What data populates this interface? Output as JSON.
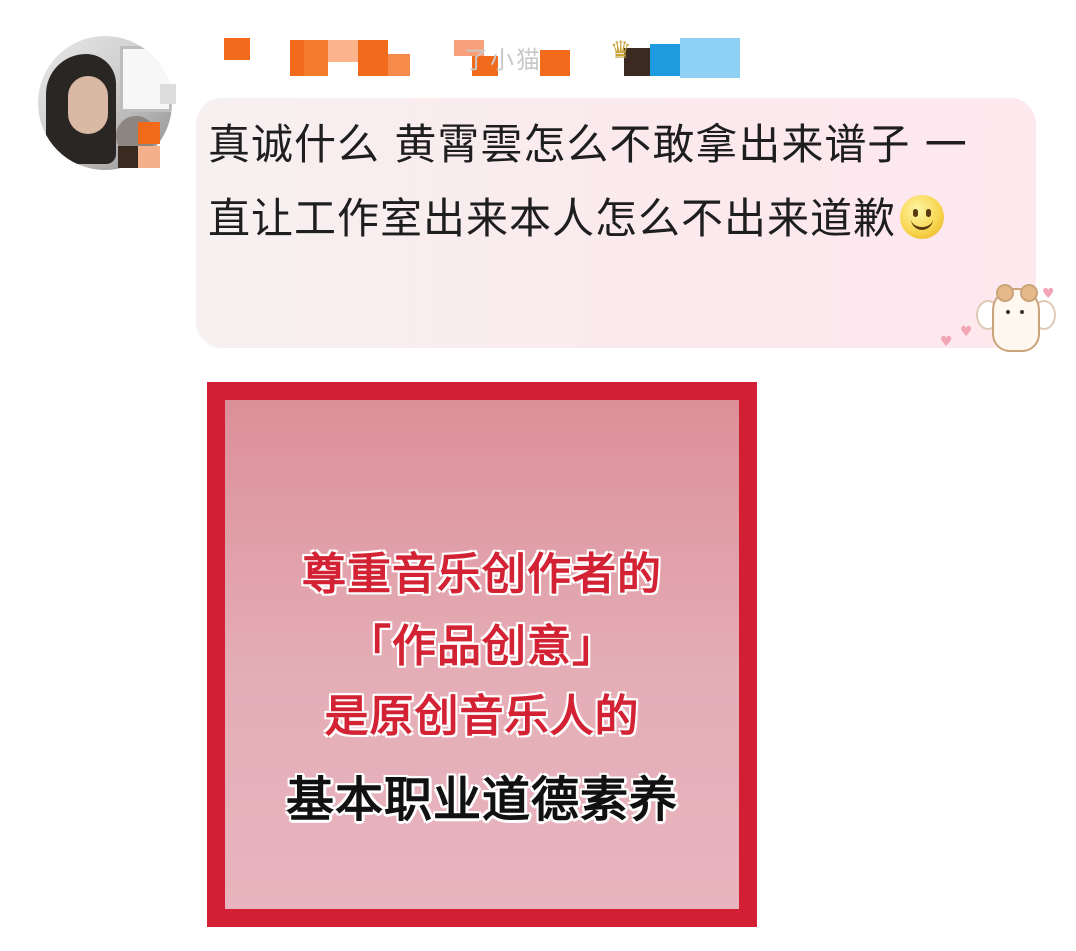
{
  "colors": {
    "accent_red": "#d21f33",
    "bubble_pink": "#fbe9ed",
    "text": "#1e1e1e"
  },
  "user": {
    "avatar_icon": "user-avatar",
    "name_obscured": "了小猫",
    "badge_icon": "crown-icon"
  },
  "comment": {
    "text": "真诚什么 黄霄雲怎么不敢拿出来谱子 一直让工作室出来本人怎么不出来道歉",
    "emoji_icon": "smile-emoji-icon",
    "sticker_icon": "hamster-angel-sticker"
  },
  "image_card": {
    "line1": "尊重音乐创作者的",
    "line2": "「作品创意」",
    "line3": "是原创音乐人的",
    "line4": "基本职业道德素养"
  }
}
